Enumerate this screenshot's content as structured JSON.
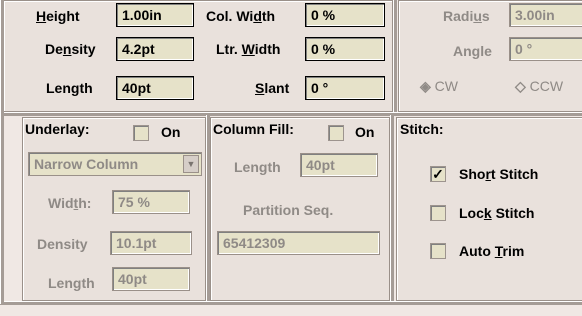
{
  "top": {
    "height": {
      "label_pre": "",
      "label_key": "H",
      "label_post": "eight",
      "value": "1.00in"
    },
    "density": {
      "label_pre": "De",
      "label_key": "n",
      "label_post": "sity",
      "value": "4.2pt"
    },
    "length": {
      "label": "Length",
      "value": "40pt"
    },
    "col_width": {
      "label_pre": "Col. Wi",
      "label_key": "d",
      "label_post": "th",
      "value": "0 %"
    },
    "ltr_width": {
      "label_pre": "Ltr. ",
      "label_key": "W",
      "label_post": "idth",
      "value": "0 %"
    },
    "slant": {
      "label_pre": "",
      "label_key": "S",
      "label_post": "lant",
      "value": "0 °"
    },
    "radius": {
      "label_pre": "Radi",
      "label_key": "u",
      "label_post": "s",
      "value": "3.00in"
    },
    "angle": {
      "label": "Angle",
      "value": "0 °"
    },
    "cw": {
      "label": "CW",
      "symbol": "◈"
    },
    "ccw": {
      "label": "CCW",
      "symbol": "◇"
    }
  },
  "underlay": {
    "title": "Underlay:",
    "on_label": "On",
    "on_checked": false,
    "type_value": "Narrow Column",
    "width": {
      "label_pre": "Wid",
      "label_key": "t",
      "label_post": "h:",
      "value": "75 %"
    },
    "density": {
      "label": "Density",
      "value": "10.1pt"
    },
    "length": {
      "label": "Length",
      "value": "40pt"
    }
  },
  "column_fill": {
    "title": "Column Fill:",
    "on_label": "On",
    "on_checked": false,
    "length": {
      "label": "Length",
      "value": "40pt"
    },
    "partition_label": "Partition Seq.",
    "partition_value": "65412309"
  },
  "stitch": {
    "title": "Stitch:",
    "short": {
      "label_pre": "Sho",
      "label_key": "r",
      "label_post": "t Stitch",
      "checked": true,
      "mark": "✓"
    },
    "lock": {
      "label_pre": "Loc",
      "label_key": "k",
      "label_post": " Stitch",
      "checked": false
    },
    "trim": {
      "label_pre": "Auto ",
      "label_key": "T",
      "label_post": "rim",
      "checked": false
    }
  }
}
